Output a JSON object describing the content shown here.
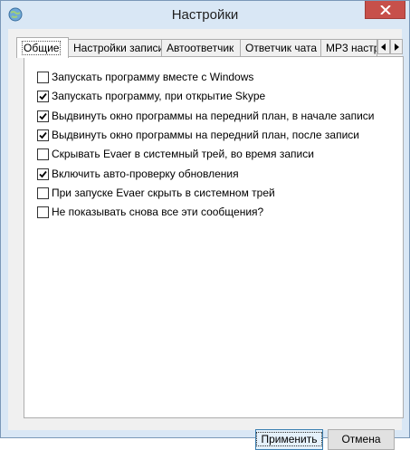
{
  "window": {
    "title": "Настройки",
    "accent": "#d9e7f5",
    "close_color": "#c7504a"
  },
  "tabs": [
    {
      "label": "Общие",
      "active": true
    },
    {
      "label": "Настройки записи",
      "active": false
    },
    {
      "label": "Автоответчик",
      "active": false
    },
    {
      "label": "Ответчик чата",
      "active": false
    },
    {
      "label": "MP3 настр",
      "active": false
    }
  ],
  "options": [
    {
      "label": "Запускать программу вместе с Windows",
      "checked": false
    },
    {
      "label": "Запускать программу, при открытие Skype",
      "checked": true
    },
    {
      "label": "Выдвинуть окно программы на передний план, в начале записи",
      "checked": true
    },
    {
      "label": "Выдвинуть окно программы на передний план, после записи",
      "checked": true
    },
    {
      "label": "Скрывать Evaer в системный трей, во время записи",
      "checked": false
    },
    {
      "label": "Включить авто-проверку обновления",
      "checked": true
    },
    {
      "label": "При запуске Evaer скрыть в системном трей",
      "checked": false
    },
    {
      "label": "Не показывать снова все эти сообщения?",
      "checked": false
    }
  ],
  "buttons": {
    "apply": "Применить",
    "cancel": "Отмена"
  }
}
